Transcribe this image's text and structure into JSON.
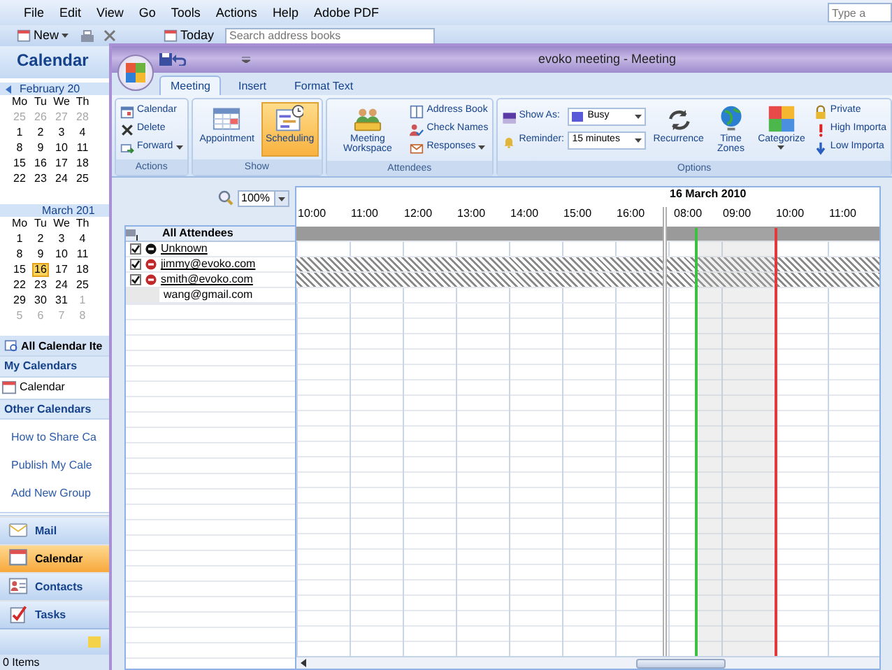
{
  "menu_bar": {
    "items": [
      "File",
      "Edit",
      "View",
      "Go",
      "Tools",
      "Actions",
      "Help",
      "Adobe PDF"
    ],
    "help_search": {
      "placeholder": "Type a"
    }
  },
  "toolbar": {
    "new_label": "New",
    "today_label": "Today",
    "search": {
      "placeholder": "Search address books"
    }
  },
  "navigation_pane": {
    "title": "Calendar",
    "months": [
      {
        "title": "February 20",
        "weekdays": [
          "Mo",
          "Tu",
          "We",
          "Th"
        ],
        "weeks": [
          [
            {
              "day": "25",
              "other_month": true,
              "selected": false
            },
            {
              "day": "26",
              "other_month": true,
              "selected": false
            },
            {
              "day": "27",
              "other_month": true,
              "selected": false
            },
            {
              "day": "28",
              "other_month": true,
              "selected": false
            }
          ],
          [
            {
              "day": "1",
              "other_month": false,
              "selected": false
            },
            {
              "day": "2",
              "other_month": false,
              "selected": false
            },
            {
              "day": "3",
              "other_month": false,
              "selected": false
            },
            {
              "day": "4",
              "other_month": false,
              "selected": false
            }
          ],
          [
            {
              "day": "8",
              "other_month": false,
              "selected": false
            },
            {
              "day": "9",
              "other_month": false,
              "selected": false
            },
            {
              "day": "10",
              "other_month": false,
              "selected": false
            },
            {
              "day": "11",
              "other_month": false,
              "selected": false
            }
          ],
          [
            {
              "day": "15",
              "other_month": false,
              "selected": false
            },
            {
              "day": "16",
              "other_month": false,
              "selected": false
            },
            {
              "day": "17",
              "other_month": false,
              "selected": false
            },
            {
              "day": "18",
              "other_month": false,
              "selected": false
            }
          ],
          [
            {
              "day": "22",
              "other_month": false,
              "selected": false
            },
            {
              "day": "23",
              "other_month": false,
              "selected": false
            },
            {
              "day": "24",
              "other_month": false,
              "selected": false
            },
            {
              "day": "25",
              "other_month": false,
              "selected": false
            }
          ]
        ]
      },
      {
        "title": "March 201",
        "weekdays": [
          "Mo",
          "Tu",
          "We",
          "Th"
        ],
        "weeks": [
          [
            {
              "day": "1",
              "other_month": false,
              "selected": false
            },
            {
              "day": "2",
              "other_month": false,
              "selected": false
            },
            {
              "day": "3",
              "other_month": false,
              "selected": false
            },
            {
              "day": "4",
              "other_month": false,
              "selected": false
            }
          ],
          [
            {
              "day": "8",
              "other_month": false,
              "selected": false
            },
            {
              "day": "9",
              "other_month": false,
              "selected": false
            },
            {
              "day": "10",
              "other_month": false,
              "selected": false
            },
            {
              "day": "11",
              "other_month": false,
              "selected": false
            }
          ],
          [
            {
              "day": "15",
              "other_month": false,
              "selected": false
            },
            {
              "day": "16",
              "other_month": false,
              "selected": true
            },
            {
              "day": "17",
              "other_month": false,
              "selected": false
            },
            {
              "day": "18",
              "other_month": false,
              "selected": false
            }
          ],
          [
            {
              "day": "22",
              "other_month": false,
              "selected": false
            },
            {
              "day": "23",
              "other_month": false,
              "selected": false
            },
            {
              "day": "24",
              "other_month": false,
              "selected": false
            },
            {
              "day": "25",
              "other_month": false,
              "selected": false
            }
          ],
          [
            {
              "day": "29",
              "other_month": false,
              "selected": false
            },
            {
              "day": "30",
              "other_month": false,
              "selected": false
            },
            {
              "day": "31",
              "other_month": false,
              "selected": false
            },
            {
              "day": "1",
              "other_month": true,
              "selected": false
            }
          ],
          [
            {
              "day": "5",
              "other_month": true,
              "selected": false
            },
            {
              "day": "6",
              "other_month": true,
              "selected": false
            },
            {
              "day": "7",
              "other_month": true,
              "selected": false
            },
            {
              "day": "8",
              "other_month": true,
              "selected": false
            }
          ]
        ]
      }
    ],
    "folders": [
      {
        "kind": "all",
        "label": "All Calendar Ite"
      },
      {
        "kind": "header",
        "label": "My Calendars"
      },
      {
        "kind": "calendar",
        "label": "Calendar"
      },
      {
        "kind": "header",
        "label": "Other Calendars"
      }
    ],
    "links": [
      "How to Share Ca",
      "Publish My Cale",
      "Add New Group"
    ],
    "nav_buttons": [
      {
        "kind": "mail",
        "label": "Mail",
        "selected": false
      },
      {
        "kind": "calendar",
        "label": "Calendar",
        "selected": true
      },
      {
        "kind": "contacts",
        "label": "Contacts",
        "selected": false
      },
      {
        "kind": "tasks",
        "label": "Tasks",
        "selected": false
      }
    ],
    "status_bar": "0 Items"
  },
  "meeting_window": {
    "title": "evoko meeting - Meeting",
    "tabs": [
      {
        "label": "Meeting",
        "selected": true
      },
      {
        "label": "Insert",
        "selected": false
      },
      {
        "label": "Format Text",
        "selected": false
      }
    ],
    "ribbon": [
      {
        "label": "Actions",
        "small_buttons": [
          {
            "kind": "calendar",
            "label": "Calendar",
            "dropdown": false
          },
          {
            "kind": "delete",
            "label": "Delete",
            "dropdown": false
          },
          {
            "kind": "forward",
            "label": "Forward",
            "dropdown": true
          }
        ]
      },
      {
        "label": "Show",
        "large_buttons": [
          {
            "kind": "appointment",
            "label": "Appointment",
            "selected": false
          },
          {
            "kind": "scheduling",
            "label": "Scheduling",
            "selected": true
          }
        ]
      },
      {
        "label": "Attendees",
        "large_buttons": [
          {
            "kind": "workspace",
            "label": "Meeting Workspace"
          }
        ],
        "small_buttons": [
          {
            "kind": "address-book",
            "label": "Address Book",
            "dropdown": false
          },
          {
            "kind": "check-names",
            "label": "Check Names",
            "dropdown": false
          },
          {
            "kind": "responses",
            "label": "Responses",
            "dropdown": true
          }
        ]
      },
      {
        "label": "Options",
        "show_as": {
          "label": "Show As:",
          "value": "Busy"
        },
        "reminder": {
          "label": "Reminder:",
          "value": "15 minutes"
        },
        "large_buttons": [
          {
            "kind": "recurrence",
            "label": "Recurrence",
            "dropdown": false
          },
          {
            "kind": "time-zones",
            "label": "Time Zones",
            "dropdown": false
          },
          {
            "kind": "categorize",
            "label": "Categorize",
            "dropdown": true
          }
        ],
        "small_buttons": [
          {
            "kind": "private",
            "label": "Private",
            "dropdown": false
          },
          {
            "kind": "high",
            "label": "High Importa",
            "dropdown": false
          },
          {
            "kind": "low",
            "label": "Low Importa",
            "dropdown": false
          }
        ]
      }
    ],
    "scheduling": {
      "zoom": "100%",
      "attendees_header": "All Attendees",
      "all_busy": true,
      "attendees": [
        {
          "kind": "attendee",
          "name": "Unknown",
          "checked": true,
          "organizer": true,
          "tentative": false
        },
        {
          "kind": "attendee",
          "name": "jimmy@evoko.com",
          "checked": true,
          "organizer": false,
          "tentative": true
        },
        {
          "kind": "attendee",
          "name": "smith@evoko.com",
          "checked": true,
          "organizer": false,
          "tentative": true
        },
        {
          "kind": "entry",
          "name": "wang@gmail.com",
          "tentative": false
        }
      ],
      "date": "16 March 2010",
      "hours": [
        {
          "label": "10:00",
          "new_day": false,
          "meeting_starts_half_past": false,
          "meeting_ends": false
        },
        {
          "label": "11:00",
          "new_day": false,
          "meeting_starts_half_past": false,
          "meeting_ends": false
        },
        {
          "label": "12:00",
          "new_day": false,
          "meeting_starts_half_past": false,
          "meeting_ends": false
        },
        {
          "label": "13:00",
          "new_day": false,
          "meeting_starts_half_past": false,
          "meeting_ends": false
        },
        {
          "label": "14:00",
          "new_day": false,
          "meeting_starts_half_past": false,
          "meeting_ends": false
        },
        {
          "label": "15:00",
          "new_day": false,
          "meeting_starts_half_past": false,
          "meeting_ends": false
        },
        {
          "label": "16:00",
          "new_day": false,
          "meeting_starts_half_past": false,
          "meeting_ends": false
        },
        {
          "label": "08:00",
          "new_day": true,
          "meeting_starts_half_past": true,
          "meeting_ends": false
        },
        {
          "label": "09:00",
          "new_day": false,
          "meeting_starts_half_past": false,
          "meeting_ends": false
        },
        {
          "label": "10:00",
          "new_day": false,
          "meeting_starts_half_past": false,
          "meeting_ends": true
        },
        {
          "label": "11:00",
          "new_day": false,
          "meeting_starts_half_past": false,
          "meeting_ends": false
        }
      ]
    }
  }
}
